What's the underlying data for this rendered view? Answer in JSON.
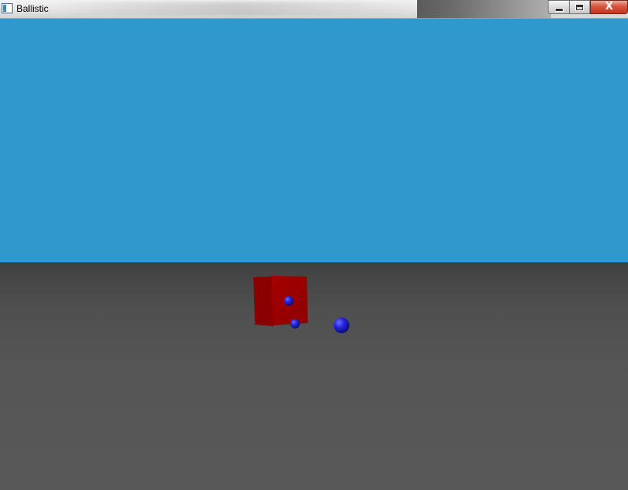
{
  "window": {
    "title": "Ballistic",
    "controls": {
      "minimize": "—",
      "maximize": "□",
      "close": "X"
    }
  },
  "scene": {
    "sky_color": "#2f98cd",
    "ground_color": "#555555",
    "objects": [
      {
        "kind": "cube",
        "color": "#a00000"
      },
      {
        "kind": "sphere",
        "color": "#1c1ccc"
      },
      {
        "kind": "sphere",
        "color": "#1c1ccc"
      },
      {
        "kind": "sphere",
        "color": "#1c1ccc"
      }
    ]
  }
}
